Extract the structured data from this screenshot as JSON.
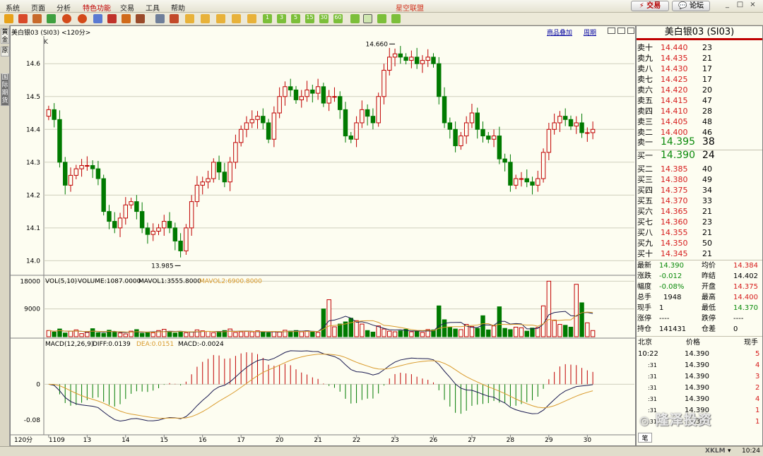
{
  "menu": {
    "items": [
      "系统",
      "页面",
      "分析",
      "特色功能",
      "交易",
      "工具",
      "帮助"
    ],
    "app_title": "星空联盟",
    "trade_button": "交易",
    "forum_button": "论坛"
  },
  "toolbar": {
    "period_buttons": [
      "1",
      "3",
      "5",
      "15",
      "30",
      "60"
    ]
  },
  "left_tabs": [
    "黄金",
    "原",
    "国际期货"
  ],
  "chart_header": {
    "instrument": "美白银03 (SI03) <120分>",
    "overlay_link": "商品叠加",
    "period_link": "周期",
    "k_label": "K"
  },
  "chart_data": [
    {
      "type": "candlestick",
      "name": "price",
      "ylim": [
        13.96,
        14.68
      ],
      "yticks": [
        14.0,
        14.1,
        14.2,
        14.3,
        14.4,
        14.5,
        14.6
      ],
      "high_label": "14.660",
      "low_label": "13.985",
      "xticks": [
        "1109",
        "13",
        "14",
        "15",
        "16",
        "17",
        "20",
        "21",
        "22",
        "23",
        "26",
        "27",
        "28",
        "29",
        "30"
      ],
      "close": [
        14.46,
        14.43,
        14.3,
        14.23,
        14.26,
        14.28,
        14.29,
        14.29,
        14.28,
        14.25,
        14.15,
        14.12,
        14.1,
        14.13,
        14.17,
        14.18,
        14.15,
        14.1,
        14.08,
        14.09,
        14.1,
        14.12,
        14.1,
        14.06,
        14.03,
        14.1,
        14.18,
        14.23,
        14.24,
        14.25,
        14.3,
        14.27,
        14.24,
        14.3,
        14.36,
        14.4,
        14.42,
        14.43,
        14.44,
        14.42,
        14.37,
        14.45,
        14.5,
        14.53,
        14.52,
        14.49,
        14.5,
        14.52,
        14.51,
        14.53,
        14.48,
        14.5,
        14.5,
        14.46,
        14.38,
        14.37,
        14.42,
        14.46,
        14.44,
        14.42,
        14.5,
        14.58,
        14.62,
        14.63,
        14.62,
        14.61,
        14.62,
        14.6,
        14.61,
        14.62,
        14.6,
        14.5,
        14.42,
        14.4,
        14.35,
        14.38,
        14.42,
        14.45,
        14.4,
        14.38,
        14.37,
        14.38,
        14.31,
        14.3,
        14.23,
        14.25,
        14.25,
        14.24,
        14.23,
        14.25,
        14.33,
        14.4,
        14.42,
        14.44,
        14.43,
        14.41,
        14.42,
        14.39,
        14.39,
        14.4
      ],
      "volume_ylim": [
        0,
        19000
      ],
      "volume_yticks": [
        9000,
        18000
      ],
      "volume": [
        2000,
        1500,
        2500,
        1200,
        1800,
        2200,
        1000,
        1400,
        2600,
        1300,
        1100,
        2100,
        1600,
        1200,
        900,
        1800,
        2300,
        1100,
        1500,
        1300,
        2000,
        2400,
        1700,
        1200,
        1600,
        1300,
        1500,
        2200,
        1900,
        1700,
        1300,
        1500,
        2000,
        2500,
        1400,
        1600,
        1700,
        1600,
        1900,
        1400,
        1300,
        1700,
        1500,
        2100,
        1800,
        2000,
        1600,
        1900,
        1500,
        1400,
        9000,
        12000,
        3200,
        4100,
        4800,
        6000,
        5200,
        4100,
        2000,
        1500,
        3500,
        2500,
        1800,
        1600,
        1900,
        2400,
        1600,
        1800,
        1400,
        2300,
        2200,
        10000,
        5500,
        3000,
        2500,
        2300,
        4000,
        3300,
        2700,
        6800,
        2200,
        3500,
        9700,
        2700,
        2300,
        3100,
        2900,
        1800,
        2800,
        3000,
        10000,
        18000,
        5400,
        4000,
        3700,
        3100,
        17000,
        11000,
        4500,
        2000
      ],
      "volume_indicator": {
        "label": "VOL(5,10)",
        "volume": "VOLUME:1087.0000",
        "mavol1": "MAVOL1:3555.8000",
        "mavol2": "MAVOL2:6900.8000"
      },
      "macd_ylim": [
        -0.11,
        0.1
      ],
      "macd_yticks": [
        "0",
        "-0.08"
      ],
      "macd_indicator": {
        "label": "MACD(12,26,9)",
        "diff": "DIFF:0.0139",
        "dea": "DEA:0.0151",
        "macd": "MACD:-0.0024"
      },
      "period_label": "120分",
      "colors": {
        "up": "#c00000",
        "down": "#007a00",
        "diff_line": "#1a1a50",
        "dea_line": "#d99a2b",
        "mavol2": "#d99a2b"
      }
    }
  ],
  "right_panel": {
    "title": "美白银03 (SI03)",
    "asks": [
      {
        "label": "卖十",
        "price": "14.440",
        "qty": "23"
      },
      {
        "label": "卖九",
        "price": "14.435",
        "qty": "21"
      },
      {
        "label": "卖八",
        "price": "14.430",
        "qty": "17"
      },
      {
        "label": "卖七",
        "price": "14.425",
        "qty": "17"
      },
      {
        "label": "卖六",
        "price": "14.420",
        "qty": "20"
      },
      {
        "label": "卖五",
        "price": "14.415",
        "qty": "47"
      },
      {
        "label": "卖四",
        "price": "14.410",
        "qty": "28"
      },
      {
        "label": "卖三",
        "price": "14.405",
        "qty": "48"
      },
      {
        "label": "卖二",
        "price": "14.400",
        "qty": "46"
      }
    ],
    "ask1": {
      "label": "卖一",
      "price": "14.395",
      "qty": "38"
    },
    "bid1": {
      "label": "买一",
      "price": "14.390",
      "qty": "24"
    },
    "bids": [
      {
        "label": "买二",
        "price": "14.385",
        "qty": "40"
      },
      {
        "label": "买三",
        "price": "14.380",
        "qty": "49"
      },
      {
        "label": "买四",
        "price": "14.375",
        "qty": "34"
      },
      {
        "label": "买五",
        "price": "14.370",
        "qty": "33"
      },
      {
        "label": "买六",
        "price": "14.365",
        "qty": "21"
      },
      {
        "label": "买七",
        "price": "14.360",
        "qty": "23"
      },
      {
        "label": "买八",
        "price": "14.355",
        "qty": "21"
      },
      {
        "label": "买九",
        "price": "14.350",
        "qty": "50"
      },
      {
        "label": "买十",
        "price": "14.345",
        "qty": "21"
      }
    ],
    "stats": [
      {
        "l1": "最新",
        "v1": "14.390",
        "l2": "均价",
        "v2": "14.384"
      },
      {
        "l1": "涨跌",
        "v1": "-0.012",
        "l2": "昨结",
        "v2": "14.402"
      },
      {
        "l1": "幅度",
        "v1": "-0.08%",
        "l2": "开盘",
        "v2": "14.375"
      },
      {
        "l1": "总手",
        "v1": "1948",
        "l2": "最高",
        "v2": "14.400"
      },
      {
        "l1": "现手",
        "v1": "1",
        "l2": "最低",
        "v2": "14.370"
      },
      {
        "l1": "涨停",
        "v1": "----",
        "l2": "跌停",
        "v2": "----"
      },
      {
        "l1": "持仓",
        "v1": "141431",
        "l2": "仓差",
        "v2": "0"
      }
    ],
    "ticks_header": {
      "col1": "北京",
      "col2": "价格",
      "col3": "现手"
    },
    "ticks": [
      {
        "time": "10:22",
        "price": "14.390",
        "qty": "5"
      },
      {
        "time": ":31",
        "price": "14.390",
        "qty": "4"
      },
      {
        "time": ":31",
        "price": "14.390",
        "qty": "3"
      },
      {
        "time": ":31",
        "price": "14.390",
        "qty": "2"
      },
      {
        "time": ":31",
        "price": "14.390",
        "qty": "4"
      },
      {
        "time": ":31",
        "price": "14.390",
        "qty": "1"
      },
      {
        "time": ":31",
        "price": "14.390",
        "qty": "1"
      }
    ],
    "bottom_tab": "笔"
  },
  "watermark": "隆泽投资",
  "status": {
    "market": "XKLM",
    "time": "10:24"
  }
}
